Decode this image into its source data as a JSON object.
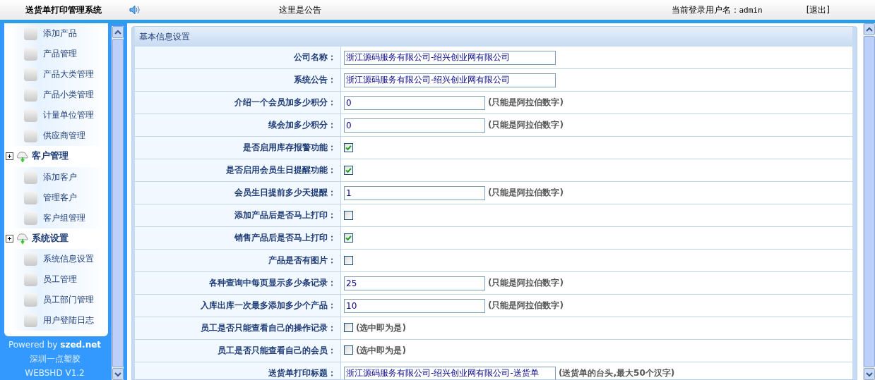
{
  "header": {
    "title": "送货单打印管理系统",
    "notice": "这里是公告",
    "user_label": "当前登录用户名：",
    "username": "admin",
    "logout": "[退出]"
  },
  "sidebar": {
    "entries": [
      {
        "kind": "item",
        "label": "添加产品"
      },
      {
        "kind": "item",
        "label": "产品管理"
      },
      {
        "kind": "item",
        "label": "产品大类管理"
      },
      {
        "kind": "item",
        "label": "产品小类管理"
      },
      {
        "kind": "item",
        "label": "计量单位管理"
      },
      {
        "kind": "item",
        "label": "供应商管理"
      },
      {
        "kind": "group",
        "label": "客户管理"
      },
      {
        "kind": "item",
        "label": "添加客户"
      },
      {
        "kind": "item",
        "label": "管理客户"
      },
      {
        "kind": "item",
        "label": "客户组管理"
      },
      {
        "kind": "group",
        "label": "系统设置"
      },
      {
        "kind": "item",
        "label": "系统信息设置"
      },
      {
        "kind": "item",
        "label": "员工管理"
      },
      {
        "kind": "item",
        "label": "员工部门管理"
      },
      {
        "kind": "item",
        "label": "用户登陆日志"
      }
    ],
    "footer": [
      "Powered by **szed.net**",
      "深圳一点塑胶",
      "WEBSHD V1.2"
    ]
  },
  "form": {
    "title": "基本信息设置",
    "rows": [
      {
        "label": "公司名称：",
        "kind": "wide_text",
        "value": "浙江源码服务有限公司-绍兴创业网有限公司"
      },
      {
        "label": "系统公告：",
        "kind": "wide_text",
        "value": "浙江源码服务有限公司-绍兴创业网有限公司"
      },
      {
        "label": "介绍一个会员加多少积分：",
        "kind": "text",
        "value": "0",
        "note": "(只能是阿拉伯数字)"
      },
      {
        "label": "续会加多少积分：",
        "kind": "text",
        "value": "0",
        "note": "(只能是阿拉伯数字)"
      },
      {
        "label": "是否启用库存报警功能：",
        "kind": "checkbox",
        "checked": true
      },
      {
        "label": "是否启用会员生日提醒功能：",
        "kind": "checkbox",
        "checked": true
      },
      {
        "label": "会员生日提前多少天提醒：",
        "kind": "text",
        "value": "1",
        "note": "(只能是阿拉伯数字)"
      },
      {
        "label": "添加产品后是否马上打印：",
        "kind": "checkbox",
        "checked": false
      },
      {
        "label": "销售产品后是否马上打印：",
        "kind": "checkbox",
        "checked": true
      },
      {
        "label": "产品是否有图片：",
        "kind": "checkbox",
        "checked": false
      },
      {
        "label": "各种查询中每页显示多少条记录：",
        "kind": "text",
        "value": "25",
        "note": "(只能是阿拉伯数字)"
      },
      {
        "label": "入库出库一次最多添加多少个产品：",
        "kind": "text",
        "value": "10",
        "note": "(只能是阿拉伯数字)"
      },
      {
        "label": "员工是否只能查看自己的操作记录：",
        "kind": "checkbox",
        "checked": false,
        "note": "(选中即为是)"
      },
      {
        "label": "员工是否只能查看自己的会员：",
        "kind": "checkbox",
        "checked": false,
        "note": "(选中即为是)"
      },
      {
        "label": "送货单打印标题：",
        "kind": "wide_text",
        "value": "浙江源码服务有限公司-绍兴创业网有限公司-送货单",
        "note": "(送货单的台头,最大50个汉字)"
      }
    ]
  }
}
